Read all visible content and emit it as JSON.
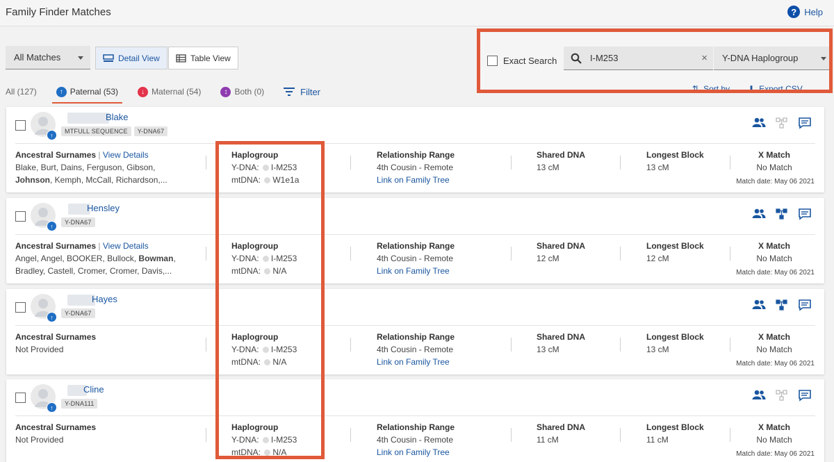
{
  "header": {
    "title": "Family Finder Matches",
    "help_label": "Help"
  },
  "toolbar": {
    "match_select": "All Matches",
    "detail_view": "Detail View",
    "table_view": "Table View"
  },
  "tabs": [
    {
      "label": "All (127)"
    },
    {
      "label": "Paternal (53)"
    },
    {
      "label": "Maternal (54)"
    },
    {
      "label": "Both (0)"
    }
  ],
  "filter_label": "Filter",
  "search": {
    "exact_label": "Exact Search",
    "value": "I-M253",
    "type_select": "Y-DNA Haplogroup",
    "sort_label": "Sort by",
    "export_label": "Export CSV"
  },
  "columns": {
    "surnames": "Ancestral Surnames",
    "view_details": "View Details",
    "haplogroup": "Haplogroup",
    "ydna": "Y-DNA:",
    "mtdna": "mtDNA:",
    "relationship": "Relationship Range",
    "shared": "Shared DNA",
    "longest": "Longest Block",
    "xmatch": "X Match",
    "family_tree_link": "Link on Family Tree",
    "match_date_label": "Match date:"
  },
  "matches": [
    {
      "name": "Blake",
      "tags": [
        "MTFULL SEQUENCE",
        "Y-DNA67"
      ],
      "surnames_line1": "Blake, Burt, Dains, Ferguson, Gibson,",
      "surnames_bold": "Johnson",
      "surnames_line2_rest": ", Kemph, McCall, Richardson,...",
      "ydna": "I-M253",
      "mtdna": "W1e1a",
      "relationship": "4th Cousin - Remote",
      "shared": "13 cM",
      "longest": "13 cM",
      "xmatch": "No Match",
      "match_date": "May 06 2021",
      "has_view_details": true
    },
    {
      "name": "Hensley",
      "tags": [
        "Y-DNA67"
      ],
      "surnames_line1_a": "Angel, Angel, BOOKER, Bullock, ",
      "surnames_line1_bold": "Bowman",
      "surnames_line1_b": ",",
      "surnames_line2": "Bradley, Castell, Cromer, Cromer, Davis,...",
      "ydna": "I-M253",
      "mtdna": "N/A",
      "relationship": "4th Cousin - Remote",
      "shared": "12 cM",
      "longest": "12 cM",
      "xmatch": "No Match",
      "match_date": "May 06 2021",
      "has_view_details": true
    },
    {
      "name": "Hayes",
      "tags": [
        "Y-DNA67"
      ],
      "surnames": "Not Provided",
      "ydna": "I-M253",
      "mtdna": "N/A",
      "relationship": "4th Cousin - Remote",
      "shared": "13 cM",
      "longest": "13 cM",
      "xmatch": "No Match",
      "match_date": "May 06 2021"
    },
    {
      "name": "Cline",
      "tags": [
        "Y-DNA111"
      ],
      "surnames": "Not Provided",
      "ydna": "I-M253",
      "mtdna": "N/A",
      "relationship": "4th Cousin - Remote",
      "shared": "11 cM",
      "longest": "11 cM",
      "xmatch": "No Match",
      "match_date": "May 06 2021"
    }
  ],
  "colors": {
    "accent": "#1a56a0",
    "highlight": "#e05a3a",
    "paternal": "#1f6ec4",
    "maternal": "#e3344b",
    "both": "#8e3bb0"
  }
}
